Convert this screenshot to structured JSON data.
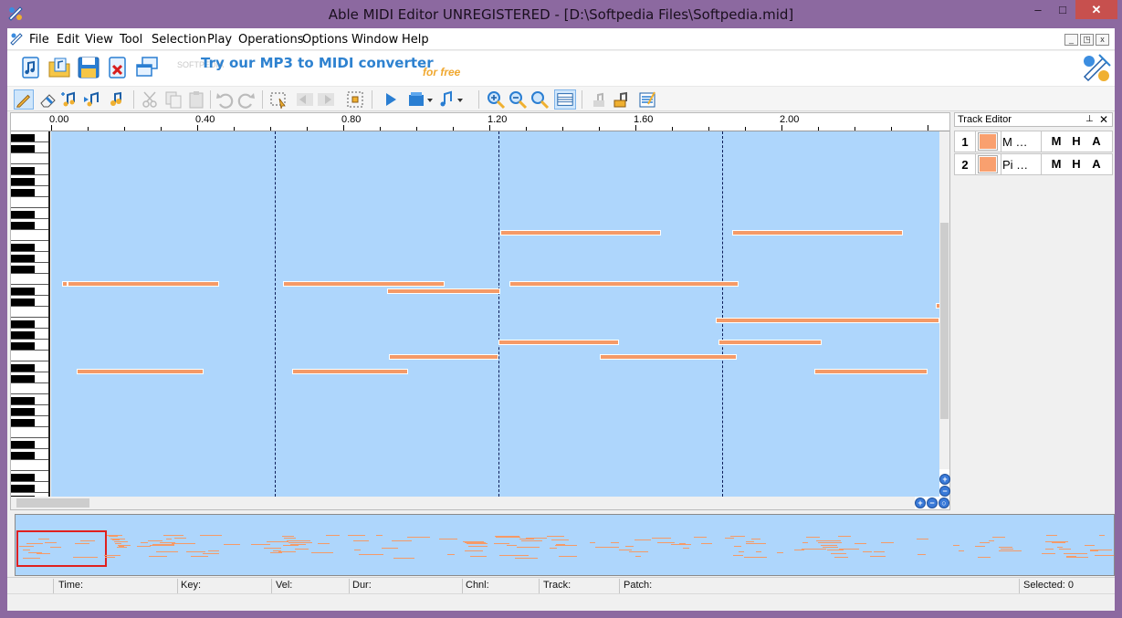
{
  "window": {
    "title": "Able MIDI Editor UNREGISTERED - [D:\\Softpedia Files\\Softpedia.mid]",
    "minimize_glyph": "–",
    "maximize_glyph": "□",
    "close_glyph": "✕"
  },
  "menu": {
    "items": [
      "File",
      "Edit",
      "View",
      "Tool",
      "Selection",
      "Play",
      "Operations",
      "Options",
      "Window",
      "Help"
    ],
    "mdi_buttons": [
      "_",
      "◳",
      "x"
    ]
  },
  "toolbar": {
    "promo_text": "Try our MP3 to MIDI converter",
    "promo_sub": "for free",
    "watermark": "SOFTPEDIA"
  },
  "ruler": {
    "labels": [
      "0.00",
      "0.40",
      "0.80",
      "1.20",
      "1.60",
      "2.00"
    ]
  },
  "track_editor": {
    "title": "Track Editor",
    "pin_glyph": "⊥",
    "close_glyph": "✕",
    "tracks": [
      {
        "num": "1",
        "name": "M …",
        "m": "M",
        "h": "H",
        "a": "A"
      },
      {
        "num": "2",
        "name": "Pi …",
        "m": "M",
        "h": "H",
        "a": "A"
      }
    ]
  },
  "status": {
    "time": "Time:",
    "key": "Key:",
    "vel": "Vel:",
    "dur": "Dur:",
    "chnl": "Chnl:",
    "track": "Track:",
    "patch": "Patch:",
    "selected": "Selected: 0"
  },
  "colors": {
    "note": "#f59a67",
    "roll_background": "#aed6fc",
    "title_bar": "#8c69a0",
    "promo": "#2e82d0",
    "promo_sub": "#f0a830",
    "overview_frame": "#e0201e"
  },
  "icons": [
    "app-logo-icon",
    "new-file-icon",
    "open-file-icon",
    "save-icon",
    "close-file-icon",
    "window-icon",
    "pencil-icon",
    "eraser-icon",
    "add-note-icon",
    "add-controller-icon",
    "instrument-icon",
    "cut-icon",
    "copy-icon",
    "paste-icon",
    "undo-icon",
    "redo-icon",
    "select-icon",
    "move-left-icon",
    "move-right-icon",
    "snap-icon",
    "play-icon",
    "record-icon",
    "metronome-icon",
    "zoom-in-icon",
    "zoom-out-icon",
    "zoom-fit-icon",
    "grid-icon",
    "tempo-icon",
    "lyrics-icon",
    "properties-icon",
    "converter-logo-icon"
  ]
}
